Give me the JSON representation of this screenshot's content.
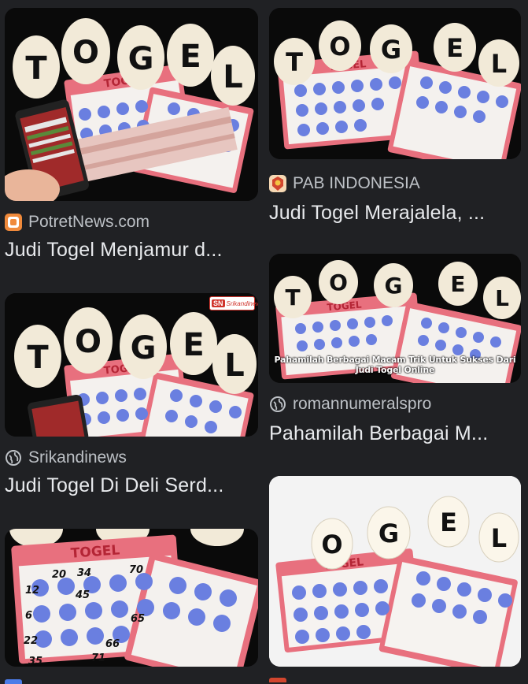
{
  "results": {
    "left": [
      {
        "id": "card-1",
        "source": "PotretNews.com",
        "title": "Judi Togel Menjamur d...",
        "icon": "orange-square-icon",
        "scene": "dark-phone",
        "balls": [
          "T",
          "O",
          "G",
          "E",
          "L"
        ]
      },
      {
        "id": "card-2",
        "source": "Srikandinews",
        "title": "Judi Togel Di Deli Serd...",
        "icon": "globe-icon",
        "scene": "dark-phone",
        "balls": [
          "T",
          "O",
          "G",
          "E",
          "L"
        ],
        "badge": {
          "mark": "SN",
          "text": "Srikandinews.com"
        }
      },
      {
        "id": "card-3",
        "scene": "tickets-only"
      }
    ],
    "right": [
      {
        "id": "card-4",
        "source": "PAB INDONESIA",
        "title": "Judi Togel Merajalela, ...",
        "icon": "emblem-icon",
        "scene": "dark",
        "balls": [
          "T",
          "O",
          "G",
          "E",
          "L"
        ]
      },
      {
        "id": "card-5",
        "source": "romannumeralspro",
        "title": "Pahamilah Berbagai M...",
        "icon": "globe-icon",
        "scene": "dark",
        "balls": [
          "T",
          "O",
          "G",
          "E",
          "L"
        ],
        "caption": "Pahamilah Berbagai Macam Trik Untuk Sukses Dari Judi Togel Online"
      },
      {
        "id": "card-6",
        "scene": "light",
        "balls": [
          "O",
          "G",
          "E",
          "L"
        ]
      }
    ]
  },
  "ticket_numbers": [
    "20",
    "34",
    "70",
    "12",
    "45",
    "6",
    "22",
    "65",
    "35",
    "71",
    "66"
  ],
  "ticket_label": "TOGEL",
  "colors": {
    "background": "#202124",
    "ticket": "#e8707e",
    "ball": "#f2ead8",
    "dot": "#6a7fe0",
    "text": "#e8eaed",
    "muted": "#bdc1c6"
  }
}
